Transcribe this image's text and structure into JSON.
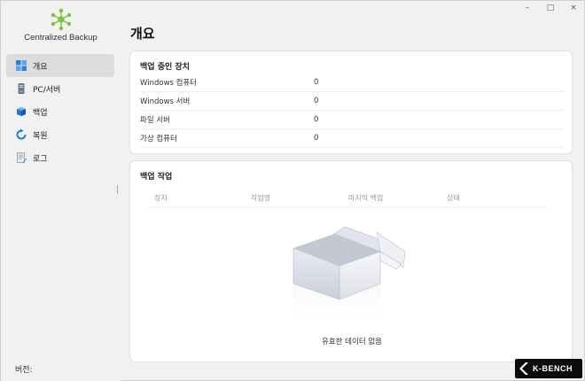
{
  "window": {
    "minimize": "–",
    "maximize": "□",
    "close": "×"
  },
  "app": {
    "name": "Centralized Backup",
    "brand_color": "#7cc23a"
  },
  "sidebar": {
    "items": [
      {
        "label": "개요",
        "icon": "dashboard-icon",
        "active": true
      },
      {
        "label": "PC/서버",
        "icon": "pc-server-icon",
        "active": false
      },
      {
        "label": "백업",
        "icon": "backup-cube-icon",
        "active": false
      },
      {
        "label": "복원",
        "icon": "restore-icon",
        "active": false
      },
      {
        "label": "로그",
        "icon": "log-icon",
        "active": false
      }
    ],
    "version_label": "버전:"
  },
  "main": {
    "title": "개요",
    "devices_card": {
      "title": "백업 중인 장치",
      "rows": [
        {
          "label": "Windows 컴퓨터",
          "value": "0"
        },
        {
          "label": "Windows 서버",
          "value": "0"
        },
        {
          "label": "파일 서버",
          "value": "0"
        },
        {
          "label": "가상 컴퓨터",
          "value": "0"
        }
      ]
    },
    "jobs_card": {
      "title": "백업 작업",
      "columns": [
        "장치",
        "작업명",
        "마지막 백업",
        "상태"
      ],
      "empty_text": "유효한 데이터 없음"
    }
  },
  "watermark": {
    "text": "K-BENCH"
  }
}
